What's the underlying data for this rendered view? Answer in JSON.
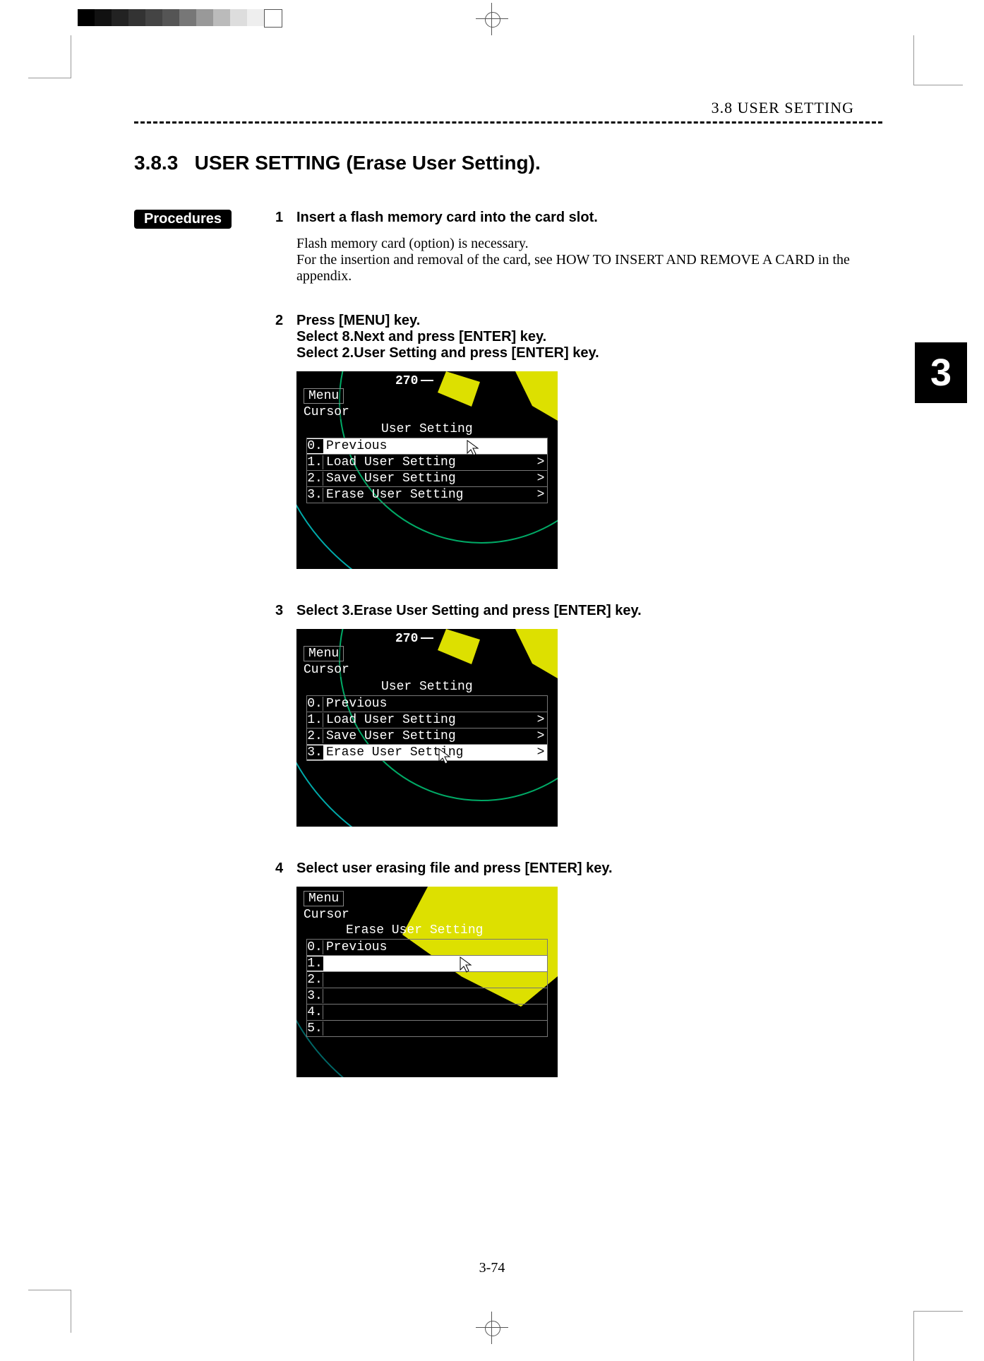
{
  "header": {
    "breadcrumb": "3.8   USER  SETTING"
  },
  "chapter_tab": "3",
  "section": {
    "number": "3.8.3",
    "title": "USER SETTING (Erase User Setting)."
  },
  "procedures_label": "Procedures",
  "steps": [
    {
      "num": "1",
      "headline": "Insert a flash memory card into the card slot.",
      "note": "Flash memory card (option) is necessary.\nFor the insertion and removal of the card, see HOW TO INSERT AND REMOVE A CARD in the appendix."
    },
    {
      "num": "2",
      "headline": "Press [MENU] key.\nSelect   8.Next   and press [ENTER] key.\nSelect   2.User Setting and press [ENTER] key."
    },
    {
      "num": "3",
      "headline": "Select 3.Erase User Setting and press [ENTER] key."
    },
    {
      "num": "4",
      "headline": "Select   user erasing file and press [ENTER] key."
    }
  ],
  "sim1": {
    "heading": "270",
    "crumb_menu": "Menu",
    "crumb_cursor": "Cursor",
    "panel_title": "User Setting",
    "rows": [
      {
        "n": "0.",
        "t": "Previous",
        "chev": "",
        "hl": true
      },
      {
        "n": "1.",
        "t": "Load User Setting",
        "chev": ">",
        "hl": false
      },
      {
        "n": "2.",
        "t": "Save User Setting",
        "chev": ">",
        "hl": false
      },
      {
        "n": "3.",
        "t": "Erase User Setting",
        "chev": ">",
        "hl": false
      }
    ]
  },
  "sim2": {
    "heading": "270",
    "crumb_menu": "Menu",
    "crumb_cursor": "Cursor",
    "panel_title": "User Setting",
    "rows": [
      {
        "n": "0.",
        "t": "Previous",
        "chev": "",
        "hl": false
      },
      {
        "n": "1.",
        "t": "Load User Setting",
        "chev": ">",
        "hl": false
      },
      {
        "n": "2.",
        "t": "Save User Setting",
        "chev": ">",
        "hl": false
      },
      {
        "n": "3.",
        "t": "Erase User Setting",
        "chev": ">",
        "hl": true
      }
    ]
  },
  "sim3": {
    "crumb_menu": "Menu",
    "crumb_cursor": "Cursor",
    "panel_title": "Erase User Setting",
    "rows": [
      {
        "n": "0.",
        "t": "Previous",
        "hl": false
      },
      {
        "n": "1.",
        "t": "",
        "hl": true
      },
      {
        "n": "2.",
        "t": "",
        "hl": false
      },
      {
        "n": "3.",
        "t": "",
        "hl": false
      },
      {
        "n": "4.",
        "t": "",
        "hl": false
      },
      {
        "n": "5.",
        "t": "",
        "hl": false
      }
    ]
  },
  "page_number": "3-74"
}
